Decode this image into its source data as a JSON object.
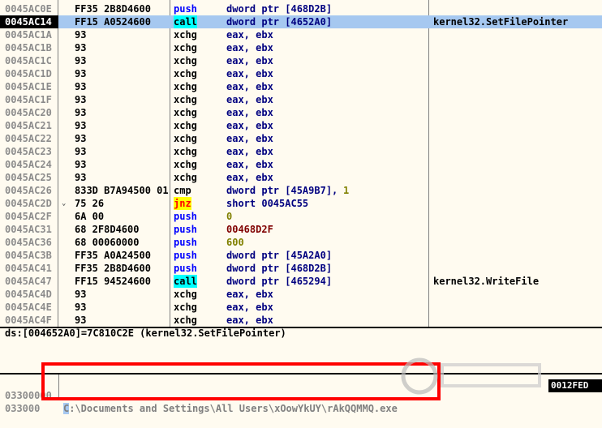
{
  "disasm": {
    "selected_index": 1,
    "rows": [
      {
        "addr": "0045AC0E",
        "hex": "FF35 2B8D4600",
        "mn": "push",
        "op": "dword ptr [468D2B]",
        "comment": ""
      },
      {
        "addr": "0045AC14",
        "hex": "FF15 A0524600",
        "mn": "call",
        "op": "dword ptr [4652A0]",
        "comment": "kernel32.SetFilePointer"
      },
      {
        "addr": "0045AC1A",
        "hex": "93",
        "mn": "xchg",
        "op": "eax, ebx",
        "comment": ""
      },
      {
        "addr": "0045AC1B",
        "hex": "93",
        "mn": "xchg",
        "op": "eax, ebx",
        "comment": ""
      },
      {
        "addr": "0045AC1C",
        "hex": "93",
        "mn": "xchg",
        "op": "eax, ebx",
        "comment": ""
      },
      {
        "addr": "0045AC1D",
        "hex": "93",
        "mn": "xchg",
        "op": "eax, ebx",
        "comment": ""
      },
      {
        "addr": "0045AC1E",
        "hex": "93",
        "mn": "xchg",
        "op": "eax, ebx",
        "comment": ""
      },
      {
        "addr": "0045AC1F",
        "hex": "93",
        "mn": "xchg",
        "op": "eax, ebx",
        "comment": ""
      },
      {
        "addr": "0045AC20",
        "hex": "93",
        "mn": "xchg",
        "op": "eax, ebx",
        "comment": ""
      },
      {
        "addr": "0045AC21",
        "hex": "93",
        "mn": "xchg",
        "op": "eax, ebx",
        "comment": ""
      },
      {
        "addr": "0045AC22",
        "hex": "93",
        "mn": "xchg",
        "op": "eax, ebx",
        "comment": ""
      },
      {
        "addr": "0045AC23",
        "hex": "93",
        "mn": "xchg",
        "op": "eax, ebx",
        "comment": ""
      },
      {
        "addr": "0045AC24",
        "hex": "93",
        "mn": "xchg",
        "op": "eax, ebx",
        "comment": ""
      },
      {
        "addr": "0045AC25",
        "hex": "93",
        "mn": "xchg",
        "op": "eax, ebx",
        "comment": ""
      },
      {
        "addr": "0045AC26",
        "hex": "833D B7A94500 01",
        "mn": "cmp",
        "op": "dword ptr [45A9B7], ",
        "op_imm": "1",
        "comment": ""
      },
      {
        "addr": "0045AC2D",
        "hex": "75 26",
        "mn": "jnz",
        "op": "short 0045AC55",
        "comment": "",
        "arrow": "⌄"
      },
      {
        "addr": "0045AC2F",
        "hex": "6A 00",
        "mn": "push",
        "op": "0",
        "comment": "",
        "op_style": "imm"
      },
      {
        "addr": "0045AC31",
        "hex": "68 2F8D4600",
        "mn": "push",
        "op": "00468D2F",
        "comment": "",
        "op_style": "jmp"
      },
      {
        "addr": "0045AC36",
        "hex": "68 00060000",
        "mn": "push",
        "op": "600",
        "comment": "",
        "op_style": "imm"
      },
      {
        "addr": "0045AC3B",
        "hex": "FF35 A0A24500",
        "mn": "push",
        "op": "dword ptr [45A2A0]",
        "comment": ""
      },
      {
        "addr": "0045AC41",
        "hex": "FF35 2B8D4600",
        "mn": "push",
        "op": "dword ptr [468D2B]",
        "comment": ""
      },
      {
        "addr": "0045AC47",
        "hex": "FF15 94524600",
        "mn": "call",
        "op": "dword ptr [465294]",
        "comment": "kernel32.WriteFile"
      },
      {
        "addr": "0045AC4D",
        "hex": "93",
        "mn": "xchg",
        "op": "eax, ebx",
        "comment": ""
      },
      {
        "addr": "0045AC4E",
        "hex": "93",
        "mn": "xchg",
        "op": "eax, ebx",
        "comment": ""
      },
      {
        "addr": "0045AC4F",
        "hex": "93",
        "mn": "xchg",
        "op": "eax, ebx",
        "comment": ""
      }
    ]
  },
  "info": {
    "text": "ds:[004652A0]=7C810C2E (kernel32.SetFilePointer)"
  },
  "dump": {
    "rows": [
      {
        "addr": "03300000",
        "first_char": "C",
        "text": ":\\Documents and Settings\\All Users\\xOowYkUY\\rAkQQMMQ.exe"
      },
      {
        "addr": "033000"
      }
    ],
    "stack_value": "0012FED"
  },
  "colors": {
    "highlight_box": "#ff0000",
    "selection": "#a6c8f0",
    "call_bg": "#00ffff",
    "jump_bg": "#ffff00"
  }
}
